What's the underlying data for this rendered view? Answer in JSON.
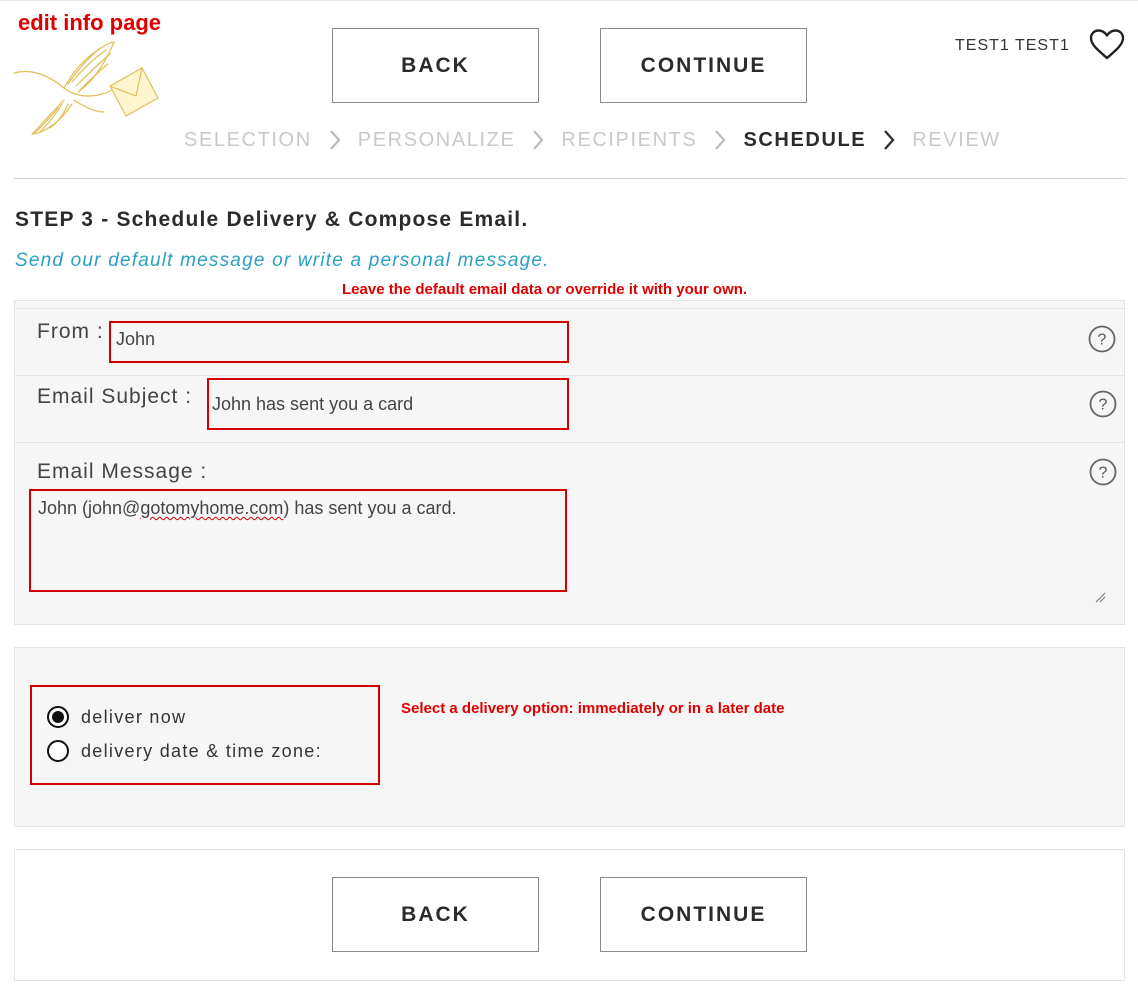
{
  "annotations": {
    "page_title": "edit info page",
    "email_note": "Leave the default email data or override it with your own.",
    "delivery_note": "Select a delivery option: immediately or in a later date"
  },
  "header": {
    "back_label": "BACK",
    "continue_label": "CONTINUE",
    "user_name": "TEST1 TEST1",
    "favorites_icon": "heart-icon",
    "logo_icon": "bird-with-envelope"
  },
  "steps": [
    {
      "label": "SELECTION",
      "active": false
    },
    {
      "label": "PERSONALIZE",
      "active": false
    },
    {
      "label": "RECIPIENTS",
      "active": false
    },
    {
      "label": "SCHEDULE",
      "active": true
    },
    {
      "label": "REVIEW",
      "active": false
    }
  ],
  "main": {
    "title": "STEP 3 - Schedule Delivery & Compose Email.",
    "subtitle": "Send our default message or write a personal message."
  },
  "form": {
    "from_label": "From :",
    "from_value": "John",
    "subject_label": "Email Subject :",
    "subject_value": "John has sent you a card",
    "message_label": "Email Message :",
    "message_value": {
      "prefix": "John (john@",
      "misspelled": "gotomyhome.com",
      "suffix": ") has sent you a card."
    }
  },
  "delivery": {
    "options": [
      {
        "label": "deliver now",
        "selected": true
      },
      {
        "label": "delivery date & time zone:",
        "selected": false
      }
    ]
  },
  "footer": {
    "back_label": "BACK",
    "continue_label": "CONTINUE"
  },
  "colors": {
    "annotation_red": "#e00000",
    "subtitle_blue": "#2aa0c4",
    "inactive_step": "#c9c9c9",
    "logo_gold": "#e8c766"
  }
}
